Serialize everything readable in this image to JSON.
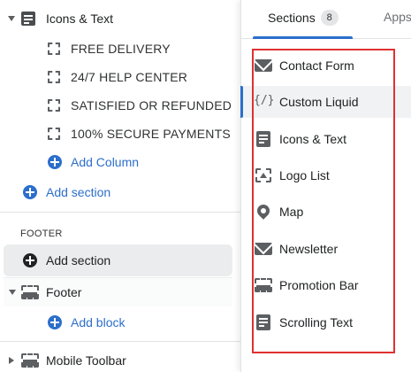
{
  "editor": {
    "icons_text_group": {
      "label": "Icons & Text",
      "blocks": [
        "FREE DELIVERY",
        "24/7 HELP CENTER",
        "SATISFIED OR REFUNDED",
        "100% SECURE PAYMENTS"
      ],
      "add_column_label": "Add Column"
    },
    "add_section_label": "Add section",
    "footer_heading": "FOOTER",
    "footer_add_section_label": "Add section",
    "footer_item_label": "Footer",
    "add_block_label": "Add block",
    "mobile_toolbar_label": "Mobile Toolbar"
  },
  "popover": {
    "tabs": [
      {
        "label": "Sections",
        "count": "8"
      },
      {
        "label": "Apps"
      }
    ],
    "items": [
      {
        "label": "Contact Form",
        "icon": "envelope-icon"
      },
      {
        "label": "Custom Liquid",
        "icon": "code-icon",
        "glyph": "{/}"
      },
      {
        "label": "Icons & Text",
        "icon": "document-icon"
      },
      {
        "label": "Logo List",
        "icon": "logo-list-icon"
      },
      {
        "label": "Map",
        "icon": "map-pin-icon"
      },
      {
        "label": "Newsletter",
        "icon": "envelope-icon"
      },
      {
        "label": "Promotion Bar",
        "icon": "promotion-bar-icon"
      },
      {
        "label": "Scrolling Text",
        "icon": "document-icon"
      }
    ]
  },
  "colors": {
    "accent_blue": "#2c6ecb",
    "highlight_border_red": "#e03131"
  }
}
